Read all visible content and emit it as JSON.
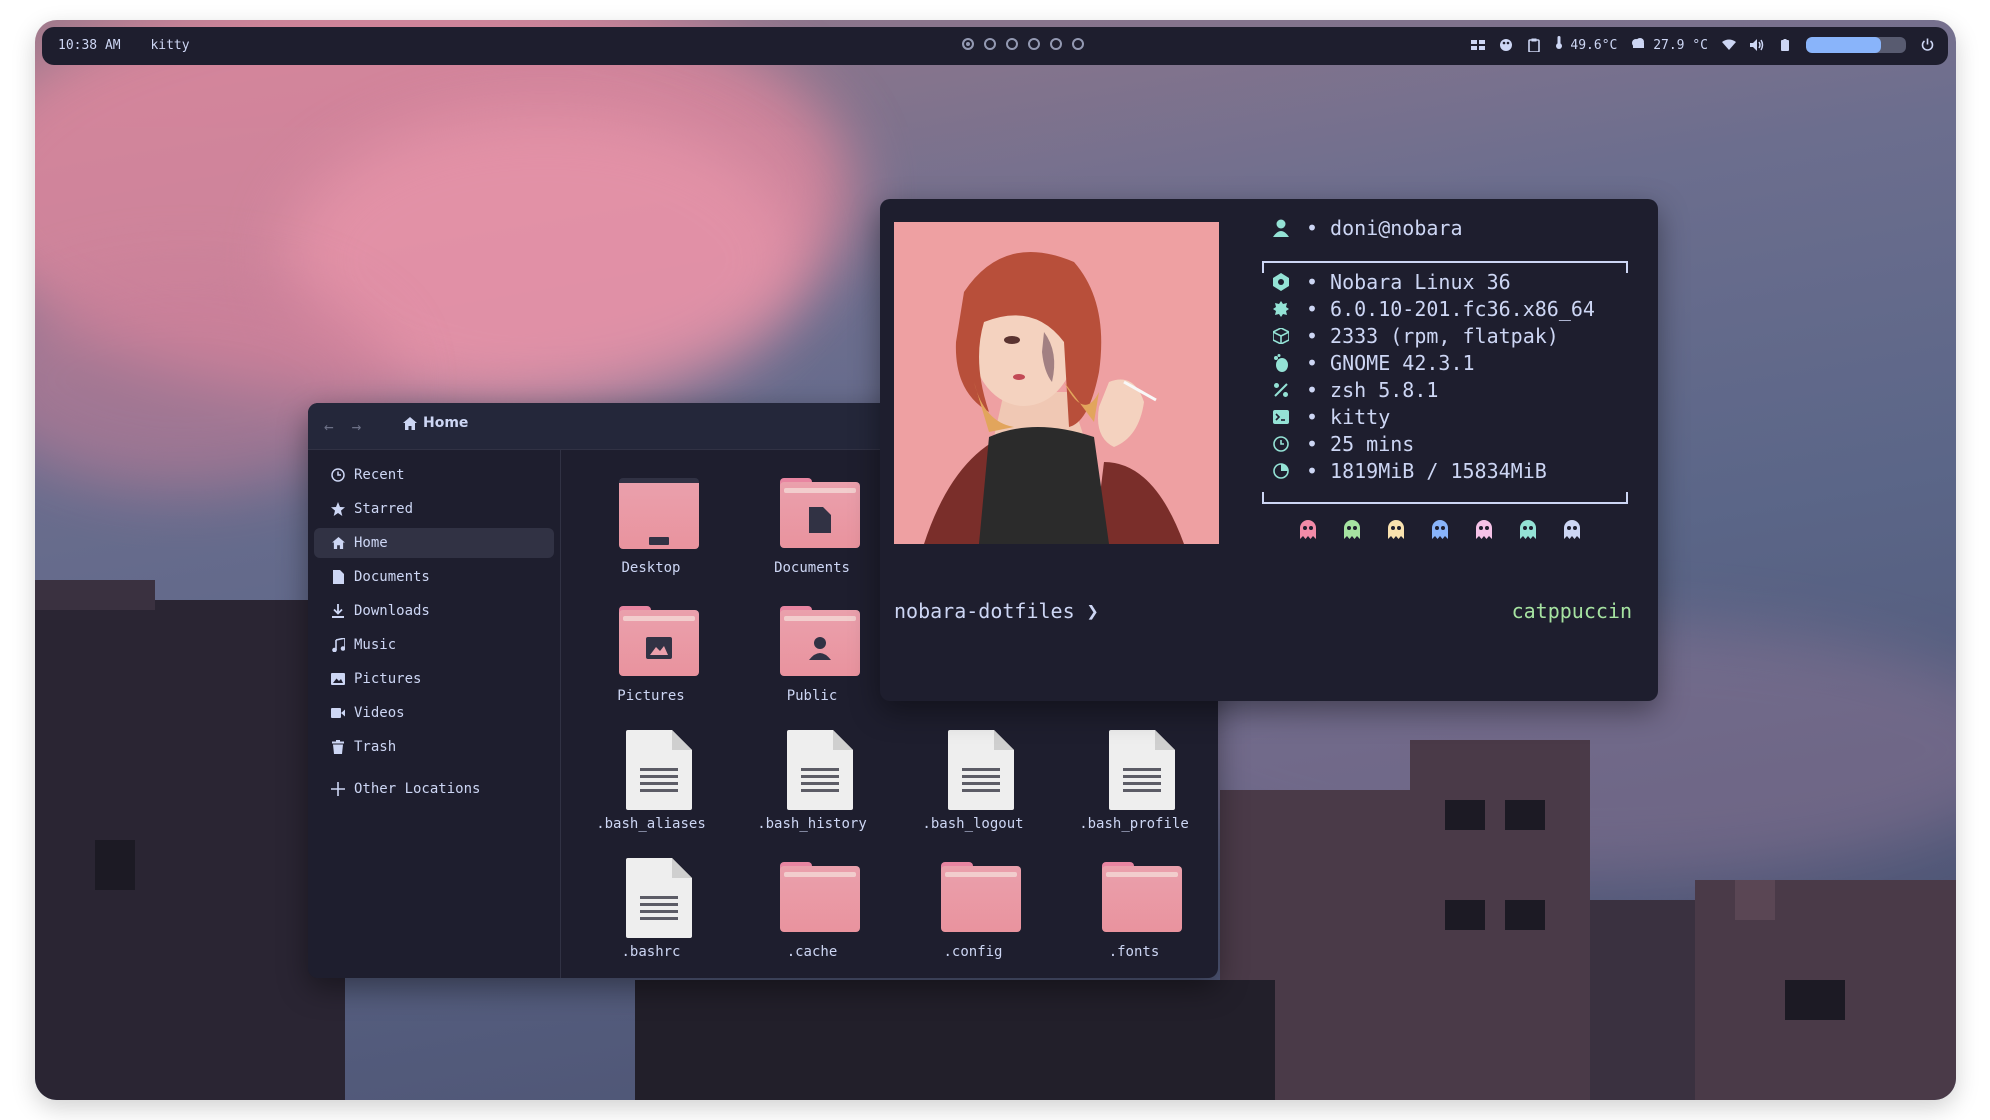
{
  "topbar": {
    "time": "10:38 AM",
    "active_window": "kitty",
    "workspaces": [
      true,
      false,
      false,
      false,
      false,
      false
    ],
    "cpu_temp": "49.6°C",
    "weather": "27.9 °C",
    "volume_level": 0.75
  },
  "file_manager": {
    "location": "Home",
    "sidebar": [
      {
        "label": "Recent",
        "icon": "clock-icon"
      },
      {
        "label": "Starred",
        "icon": "star-icon"
      },
      {
        "label": "Home",
        "icon": "home-icon",
        "active": true
      },
      {
        "label": "Documents",
        "icon": "document-icon"
      },
      {
        "label": "Downloads",
        "icon": "download-icon"
      },
      {
        "label": "Music",
        "icon": "music-icon"
      },
      {
        "label": "Pictures",
        "icon": "picture-icon"
      },
      {
        "label": "Videos",
        "icon": "video-icon"
      },
      {
        "label": "Trash",
        "icon": "trash-icon"
      },
      {
        "label": "Other Locations",
        "icon": "plus-icon"
      }
    ],
    "files": [
      {
        "name": "Desktop",
        "kind": "folder",
        "emblem": "desktop"
      },
      {
        "name": "Documents",
        "kind": "folder",
        "emblem": "document"
      },
      {
        "name": "Pictures",
        "kind": "folder",
        "emblem": "picture"
      },
      {
        "name": "Public",
        "kind": "folder",
        "emblem": "person"
      },
      {
        "name": ".bash_aliases",
        "kind": "text"
      },
      {
        "name": ".bash_history",
        "kind": "text"
      },
      {
        "name": ".bash_logout",
        "kind": "text"
      },
      {
        "name": ".bash_profile",
        "kind": "text"
      },
      {
        "name": ".bashrc",
        "kind": "text"
      },
      {
        "name": ".cache",
        "kind": "folder"
      },
      {
        "name": ".config",
        "kind": "folder"
      },
      {
        "name": ".fonts",
        "kind": "folder"
      }
    ]
  },
  "fetch": {
    "user": "doni@nobara",
    "lines": [
      {
        "icon": "distro-icon",
        "text": "Nobara Linux 36"
      },
      {
        "icon": "kernel-icon",
        "text": "6.0.10-201.fc36.x86_64"
      },
      {
        "icon": "package-icon",
        "text": "2333 (rpm, flatpak)"
      },
      {
        "icon": "gnome-icon",
        "text": "GNOME 42.3.1"
      },
      {
        "icon": "shell-icon",
        "text": "zsh 5.8.1"
      },
      {
        "icon": "terminal-icon",
        "text": "kitty"
      },
      {
        "icon": "clock-icon",
        "text": "25 mins"
      },
      {
        "icon": "memory-icon",
        "text": "1819MiB / 15834MiB"
      }
    ],
    "ghost_colors": [
      "#f38ba8",
      "#a6e3a1",
      "#f9e2af",
      "#89b4fa",
      "#f5c2e7",
      "#94e2d5",
      "#cdd6f4"
    ],
    "prompt_dir": "nobara-dotfiles",
    "prompt_arrow": "❯",
    "theme": "catppuccin"
  }
}
